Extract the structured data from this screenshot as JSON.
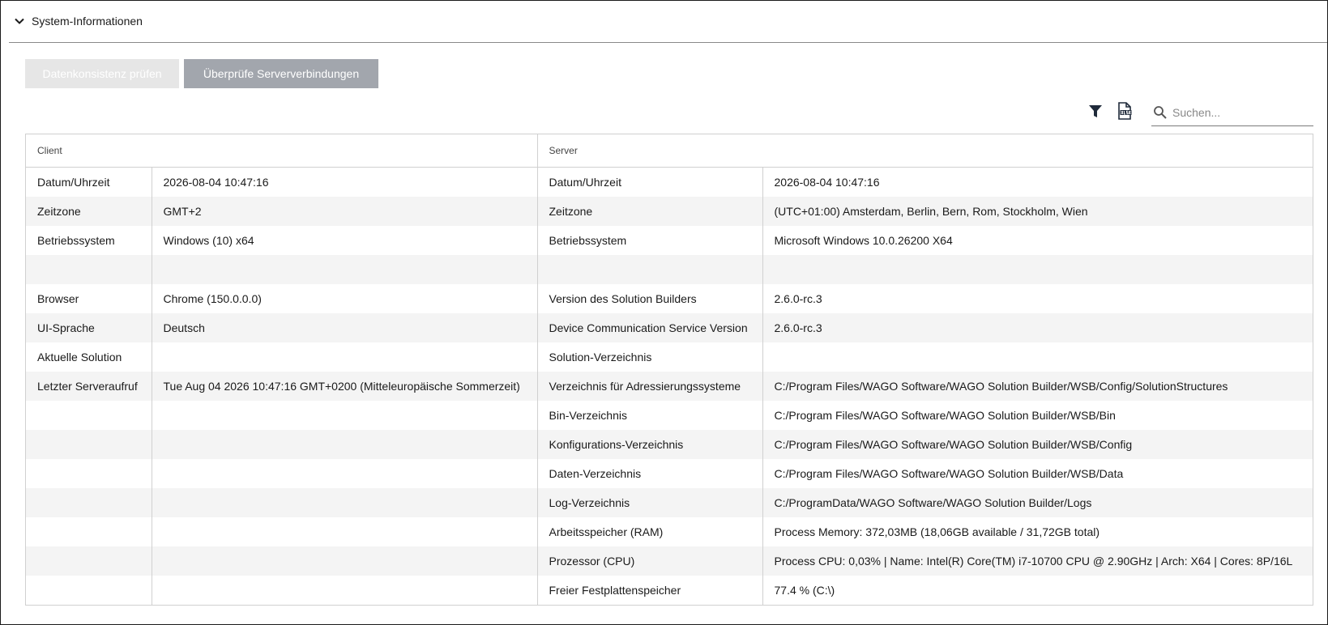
{
  "section": {
    "title": "System-Informationen"
  },
  "buttons": {
    "check_consistency": "Datenkonsistenz prüfen",
    "check_connections": "Überprüfe Serververbindungen"
  },
  "toolbar": {
    "filter_icon": "filter-icon",
    "export_icon": "xlsx-export-icon",
    "search_placeholder": "Suchen..."
  },
  "table": {
    "headers": {
      "client": "Client",
      "server": "Server"
    },
    "rows": [
      {
        "client_key": "Datum/Uhrzeit",
        "client_value": "2026-08-04 10:47:16",
        "server_key": "Datum/Uhrzeit",
        "server_value": "2026-08-04 10:47:16"
      },
      {
        "client_key": "Zeitzone",
        "client_value": "GMT+2",
        "server_key": "Zeitzone",
        "server_value": "(UTC+01:00) Amsterdam, Berlin, Bern, Rom, Stockholm, Wien"
      },
      {
        "client_key": "Betriebssystem",
        "client_value": "Windows (10) x64",
        "server_key": "Betriebssystem",
        "server_value": "Microsoft Windows 10.0.26200 X64"
      },
      {
        "client_key": "",
        "client_value": "",
        "server_key": "",
        "server_value": ""
      },
      {
        "client_key": "Browser",
        "client_value": "Chrome (150.0.0.0)",
        "server_key": "Version des Solution Builders",
        "server_value": "2.6.0-rc.3"
      },
      {
        "client_key": "UI-Sprache",
        "client_value": "Deutsch",
        "server_key": "Device Communication Service Version",
        "server_value": "2.6.0-rc.3"
      },
      {
        "client_key": "Aktuelle Solution",
        "client_value": "",
        "server_key": "Solution-Verzeichnis",
        "server_value": ""
      },
      {
        "client_key": "Letzter Serveraufruf",
        "client_value": "Tue Aug 04 2026 10:47:16 GMT+0200 (Mitteleuropäische Sommerzeit)",
        "server_key": "Verzeichnis für Adressierungssysteme",
        "server_value": "C:/Program Files/WAGO Software/WAGO Solution Builder/WSB/Config/SolutionStructures"
      },
      {
        "client_key": "",
        "client_value": "",
        "server_key": "Bin-Verzeichnis",
        "server_value": "C:/Program Files/WAGO Software/WAGO Solution Builder/WSB/Bin"
      },
      {
        "client_key": "",
        "client_value": "",
        "server_key": "Konfigurations-Verzeichnis",
        "server_value": "C:/Program Files/WAGO Software/WAGO Solution Builder/WSB/Config"
      },
      {
        "client_key": "",
        "client_value": "",
        "server_key": "Daten-Verzeichnis",
        "server_value": "C:/Program Files/WAGO Software/WAGO Solution Builder/WSB/Data"
      },
      {
        "client_key": "",
        "client_value": "",
        "server_key": "Log-Verzeichnis",
        "server_value": "C:/ProgramData/WAGO Software/WAGO Solution Builder/Logs"
      },
      {
        "client_key": "",
        "client_value": "",
        "server_key": "Arbeitsspeicher (RAM)",
        "server_value": "Process Memory: 372,03MB (18,06GB available / 31,72GB total)"
      },
      {
        "client_key": "",
        "client_value": "",
        "server_key": "Prozessor (CPU)",
        "server_value": "Process CPU: 0,03% | Name: Intel(R) Core(TM) i7-10700 CPU @ 2.90GHz | Arch: X64 | Cores: 8P/16L"
      },
      {
        "client_key": "",
        "client_value": "",
        "server_key": "Freier Festplattenspeicher",
        "server_value": "77.4 % (C:\\)"
      }
    ]
  }
}
